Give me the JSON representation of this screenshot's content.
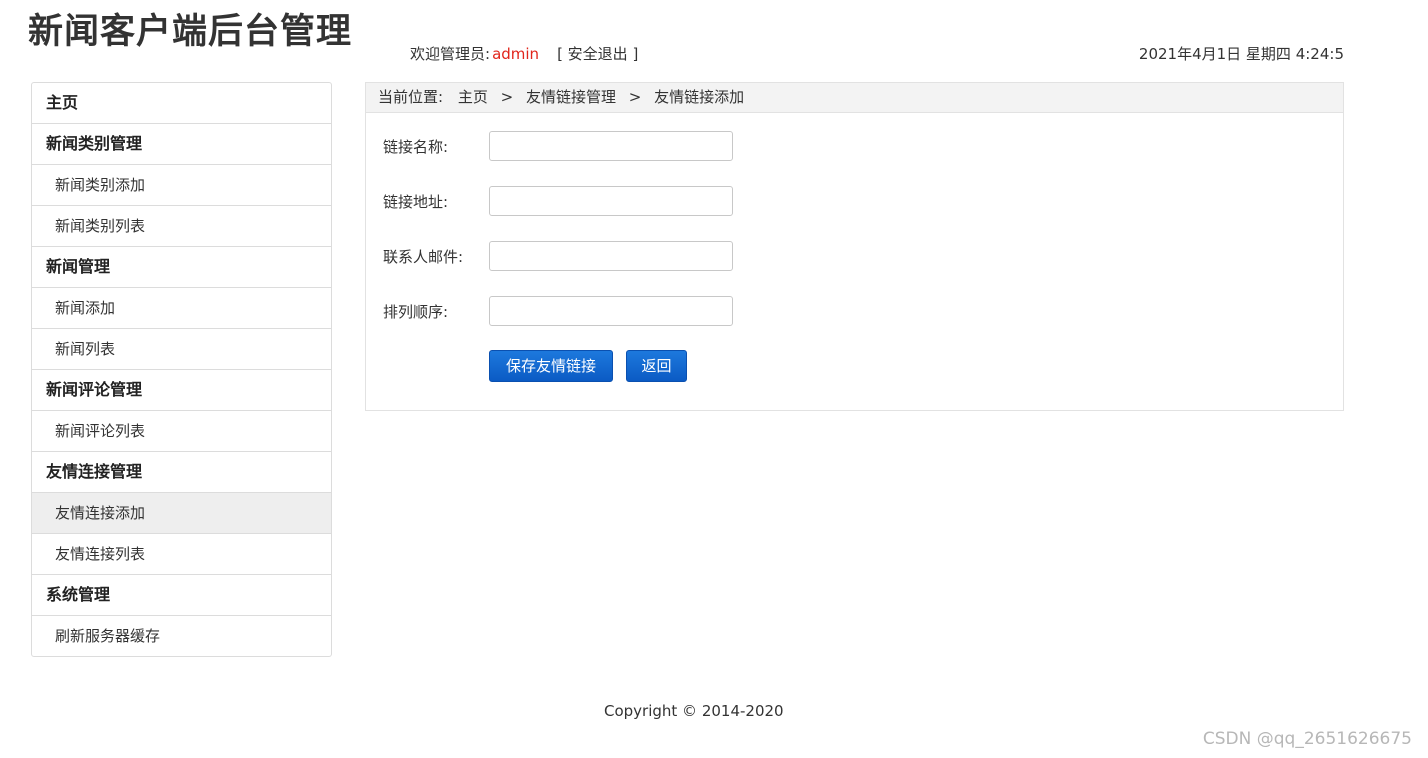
{
  "header": {
    "title": "新闻客户端后台管理",
    "welcome_label": "欢迎管理员:",
    "username": "admin",
    "logout_label": "[ 安全退出 ]",
    "datetime": "2021年4月1日 星期四 4:24:5"
  },
  "sidebar": {
    "items": [
      {
        "label": "主页",
        "type": "group"
      },
      {
        "label": "新闻类别管理",
        "type": "group"
      },
      {
        "label": "新闻类别添加",
        "type": "sub"
      },
      {
        "label": "新闻类别列表",
        "type": "sub"
      },
      {
        "label": "新闻管理",
        "type": "group"
      },
      {
        "label": "新闻添加",
        "type": "sub"
      },
      {
        "label": "新闻列表",
        "type": "sub"
      },
      {
        "label": "新闻评论管理",
        "type": "group"
      },
      {
        "label": "新闻评论列表",
        "type": "sub"
      },
      {
        "label": "友情连接管理",
        "type": "group"
      },
      {
        "label": "友情连接添加",
        "type": "sub",
        "active": true
      },
      {
        "label": "友情连接列表",
        "type": "sub"
      },
      {
        "label": "系统管理",
        "type": "group"
      },
      {
        "label": "刷新服务器缓存",
        "type": "sub"
      }
    ]
  },
  "breadcrumb": {
    "prefix": "当前位置:",
    "items": [
      "主页",
      "友情链接管理",
      "友情链接添加"
    ],
    "separator": ">"
  },
  "form": {
    "fields": [
      {
        "label": "链接名称:",
        "value": "",
        "placeholder": ""
      },
      {
        "label": "链接地址:",
        "value": "",
        "placeholder": ""
      },
      {
        "label": "联系人邮件:",
        "value": "",
        "placeholder": ""
      },
      {
        "label": "排列顺序:",
        "value": "",
        "placeholder": ""
      }
    ],
    "save_label": "保存友情链接",
    "back_label": "返回"
  },
  "footer": {
    "copyright": "Copyright © 2014-2020"
  },
  "watermark": "CSDN @qq_2651626675",
  "colors": {
    "accent": "#0b5bc4",
    "username": "#e1251b",
    "active_item_bg": "#eeeeee"
  }
}
